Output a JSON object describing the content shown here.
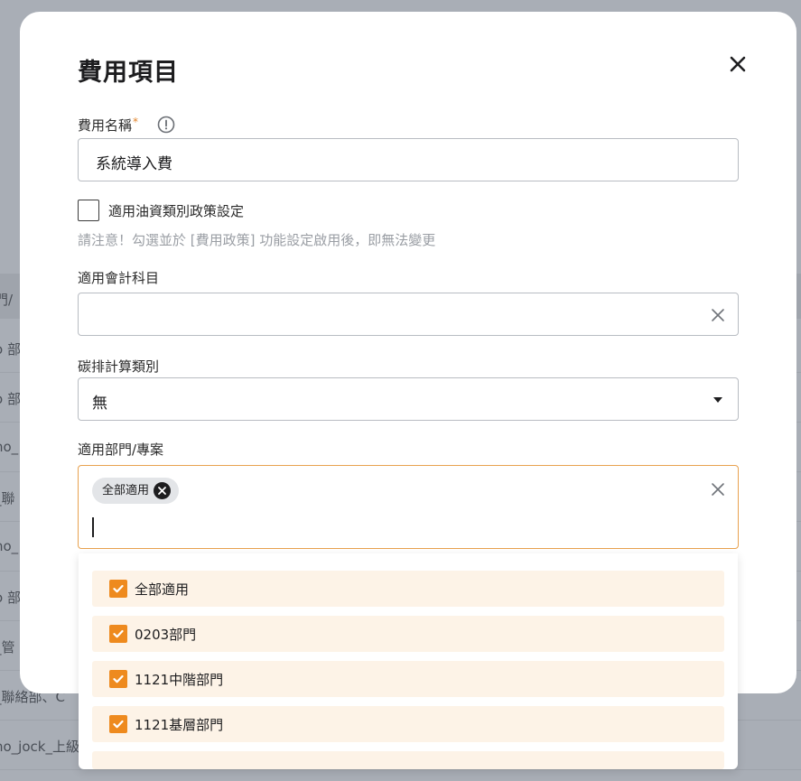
{
  "background": {
    "rows": [
      "門/",
      "o 部",
      "o 部",
      "no_",
      "_聯",
      "no_",
      "o 部",
      "_管",
      "_聯絡部、C",
      "no_jock_上級"
    ]
  },
  "modal": {
    "title": "費用項目",
    "fee_name": {
      "label": "費用名稱",
      "required_mark": "*",
      "value": "系統導入費"
    },
    "oil_policy": {
      "label": "適用油資類別政策設定",
      "checked": false,
      "hint": "請注意！勾選並於 [費用政策] 功能設定啟用後，即無法變更"
    },
    "account": {
      "label": "適用會計科目",
      "value": ""
    },
    "carbon": {
      "label": "碳排計算類別",
      "value": "無"
    },
    "department": {
      "label": "適用部門/專案",
      "chips": [
        "全部適用"
      ],
      "options": [
        {
          "label": "全部適用",
          "checked": true
        },
        {
          "label": "0203部門",
          "checked": true
        },
        {
          "label": "1121中階部門",
          "checked": true
        },
        {
          "label": "1121基層部門",
          "checked": true
        }
      ]
    }
  },
  "colors": {
    "accent": "#ee8a1e",
    "focus_border": "#e8a24f",
    "option_bg": "#fdf3e7"
  }
}
